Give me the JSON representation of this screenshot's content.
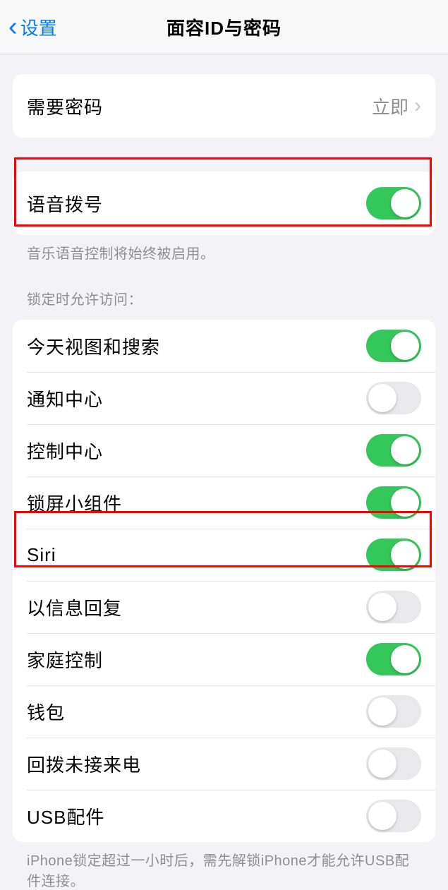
{
  "nav": {
    "back_label": "设置",
    "title": "面容ID与密码"
  },
  "require_passcode": {
    "label": "需要密码",
    "value": "立即"
  },
  "voice_dial": {
    "label": "语音拨号",
    "footer": "音乐语音控制将始终被启用。"
  },
  "lock_header": "锁定时允许访问：",
  "lock_items": [
    {
      "label": "今天视图和搜索",
      "on": true
    },
    {
      "label": "通知中心",
      "on": false
    },
    {
      "label": "控制中心",
      "on": true
    },
    {
      "label": "锁屏小组件",
      "on": true
    },
    {
      "label": "Siri",
      "on": true
    },
    {
      "label": "以信息回复",
      "on": false
    },
    {
      "label": "家庭控制",
      "on": true
    },
    {
      "label": "钱包",
      "on": false
    },
    {
      "label": "回拨未接来电",
      "on": false
    },
    {
      "label": "USB配件",
      "on": false
    }
  ],
  "usb_footer": "iPhone锁定超过一小时后，需先解锁iPhone才能允许USB配件连接。"
}
